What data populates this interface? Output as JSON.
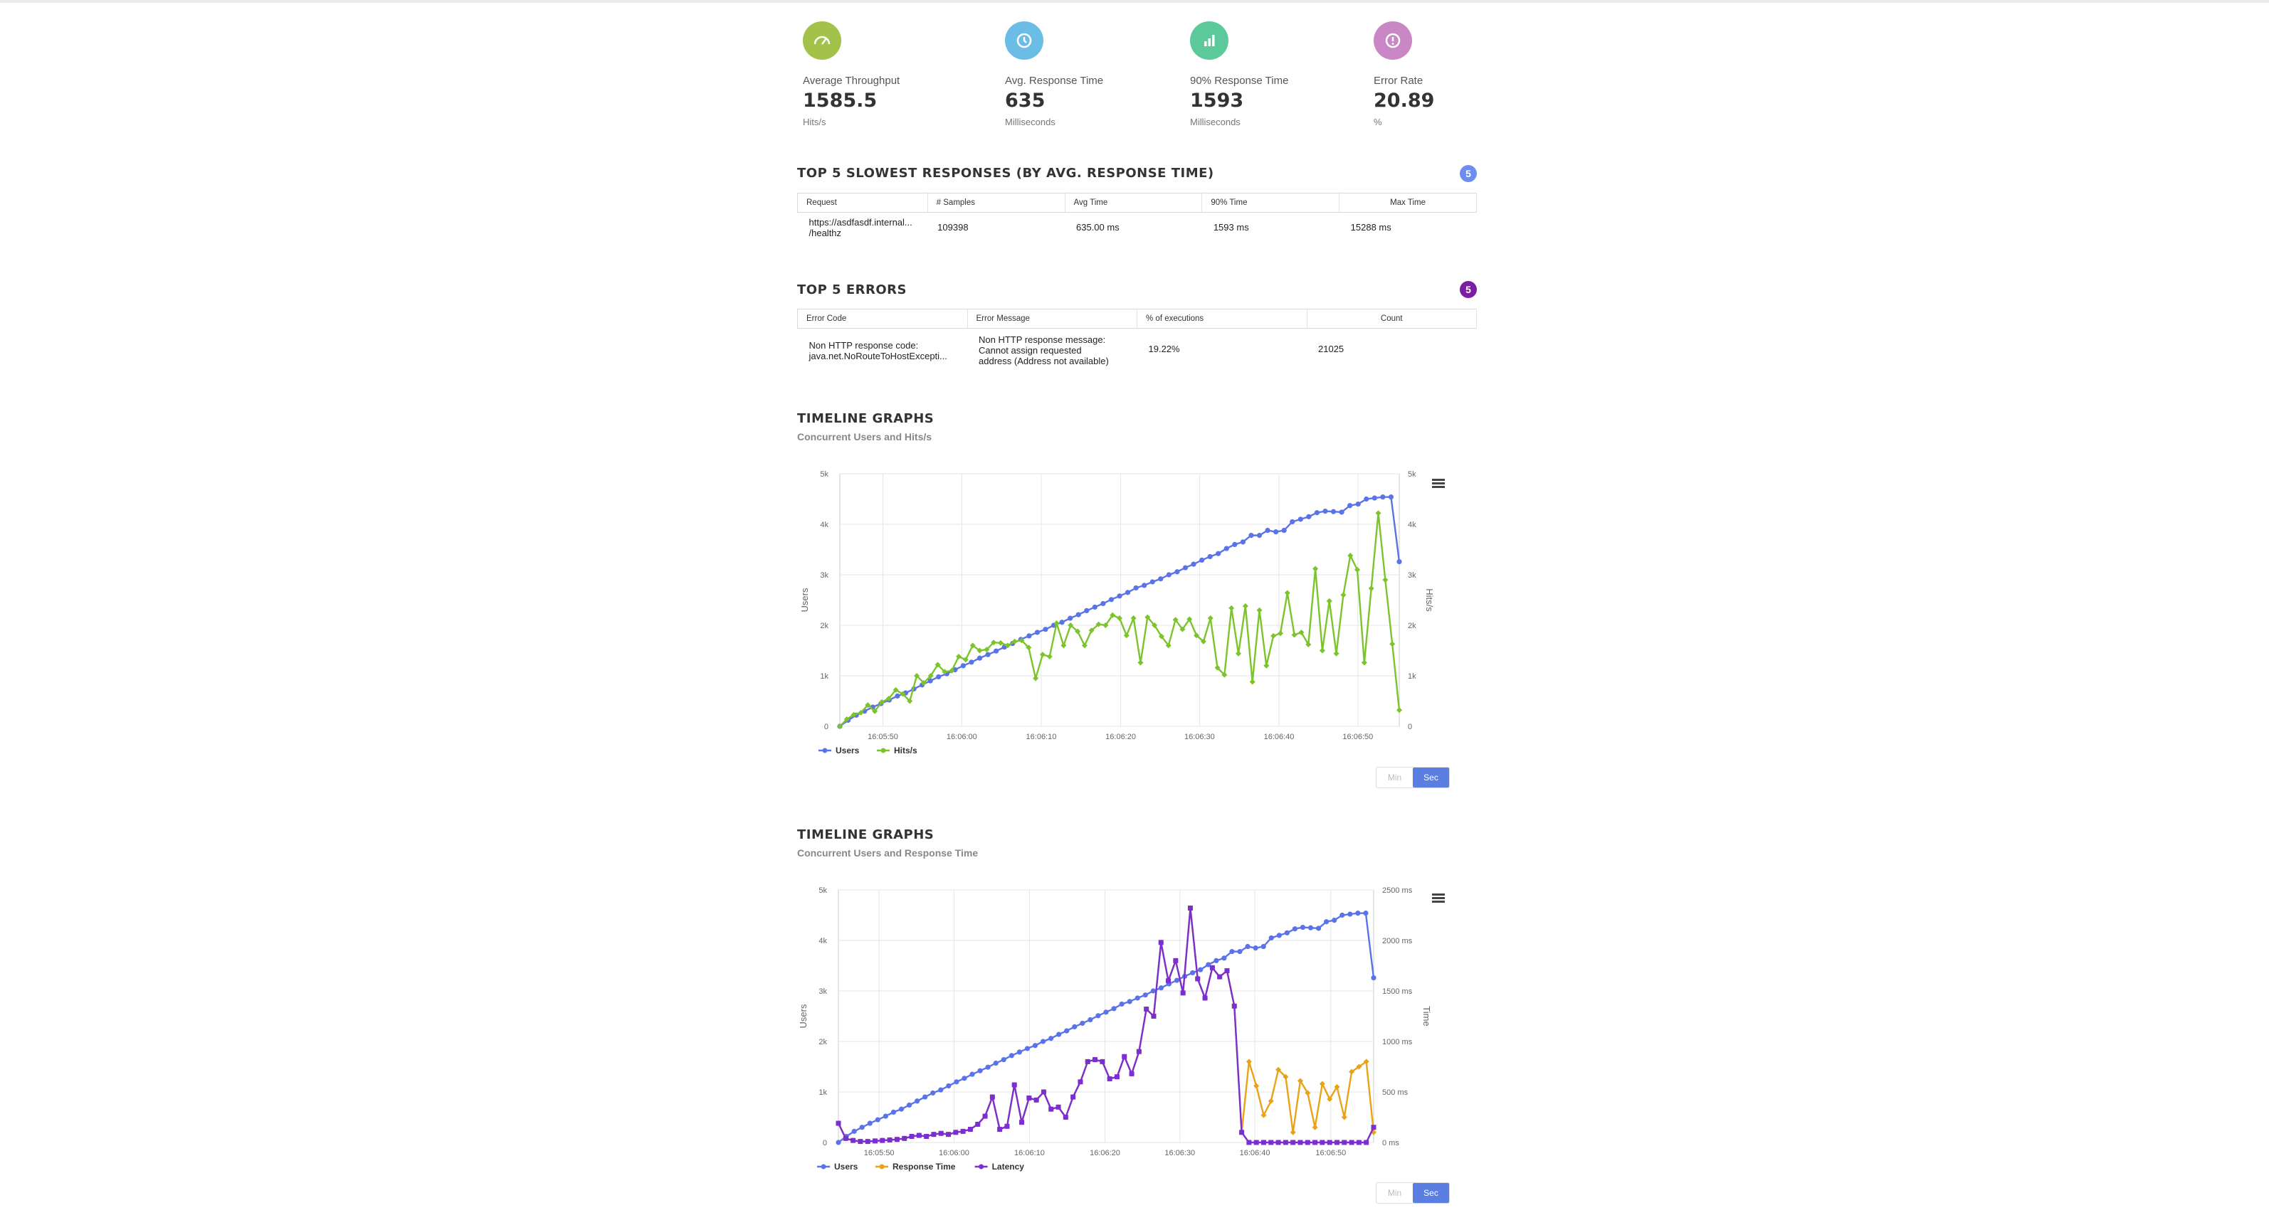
{
  "kpis": [
    {
      "label": "Average Throughput",
      "value": "1585.5",
      "unit": "Hits/s",
      "color": "#a3c24a",
      "icon": "gauge-icon"
    },
    {
      "label": "Avg. Response Time",
      "value": "635",
      "unit": "Milliseconds",
      "color": "#6cbde6",
      "icon": "clock-icon"
    },
    {
      "label": "90% Response Time",
      "value": "1593",
      "unit": "Milliseconds",
      "color": "#5cc99a",
      "icon": "bar-chart-icon"
    },
    {
      "label": "Error Rate",
      "value": "20.89",
      "unit": "%",
      "color": "#c987c6",
      "icon": "alert-icon"
    }
  ],
  "slowest": {
    "title": "TOP 5 SLOWEST RESPONSES (BY AVG. RESPONSE TIME)",
    "count": "5",
    "count_color": "#6d8ef0",
    "headers": [
      "Request",
      "# Samples",
      "Avg Time",
      "90% Time",
      "Max Time"
    ],
    "rows": [
      [
        "https://asdfasdf.internal...",
        "/healthz",
        "109398",
        "635.00 ms",
        "1593 ms",
        "15288 ms"
      ]
    ]
  },
  "errors": {
    "title": "TOP 5 ERRORS",
    "count": "5",
    "count_color": "#7a1fa2",
    "headers": [
      "Error Code",
      "Error Message",
      "% of executions",
      "Count"
    ],
    "row": {
      "code_l1": "Non HTTP response code:",
      "code_l2": "java.net.NoRouteToHostExcepti...",
      "msg_l1": "Non HTTP response message:",
      "msg_l2": "Cannot assign requested",
      "msg_l3": "address (Address not available)",
      "pct": "19.22%",
      "count": "21025"
    }
  },
  "timeline1": {
    "title": "TIMELINE GRAPHS",
    "subtitle": "Concurrent Users and Hits/s",
    "toggle_min": "Min",
    "toggle_sec": "Sec"
  },
  "timeline2": {
    "title": "TIMELINE GRAPHS",
    "subtitle": "Concurrent Users and Response Time",
    "toggle_min": "Min",
    "toggle_sec": "Sec"
  },
  "chart_data": [
    {
      "type": "line",
      "x_ticks": [
        "16:05:50",
        "16:06:00",
        "16:06:10",
        "16:06:20",
        "16:06:30",
        "16:06:40",
        "16:06:50"
      ],
      "ylabel": "Users",
      "y2label": "Hits/s",
      "y_ticks": [
        "0",
        "1k",
        "2k",
        "3k",
        "4k",
        "5k"
      ],
      "y2_ticks": [
        "0",
        "1k",
        "2k",
        "3k",
        "4k",
        "5k"
      ],
      "ylim": [
        0,
        5000
      ],
      "y2lim": [
        0,
        5000
      ],
      "grid": true,
      "legend_position": "bottom-left",
      "series": [
        {
          "name": "Users",
          "color": "#5b73e8",
          "axis": "left",
          "values": [
            0,
            120,
            220,
            300,
            380,
            450,
            520,
            600,
            660,
            740,
            820,
            900,
            980,
            1040,
            1120,
            1200,
            1270,
            1350,
            1420,
            1490,
            1570,
            1640,
            1720,
            1790,
            1860,
            1920,
            2000,
            2060,
            2140,
            2210,
            2290,
            2360,
            2430,
            2510,
            2580,
            2650,
            2740,
            2790,
            2860,
            2920,
            3000,
            3060,
            3140,
            3210,
            3290,
            3360,
            3420,
            3520,
            3600,
            3650,
            3780,
            3780,
            3880,
            3850,
            3880,
            4050,
            4100,
            4150,
            4230,
            4260,
            4250,
            4240,
            4370,
            4400,
            4500,
            4520,
            4540,
            4540,
            3260
          ]
        },
        {
          "name": "Hits/s",
          "color": "#7cc42b",
          "axis": "right",
          "values": [
            0,
            140,
            230,
            270,
            420,
            300,
            480,
            550,
            720,
            640,
            500,
            1000,
            860,
            1000,
            1220,
            1080,
            1100,
            1380,
            1320,
            1600,
            1500,
            1520,
            1660,
            1650,
            1600,
            1680,
            1700,
            1560,
            950,
            1420,
            1380,
            2040,
            1600,
            2000,
            1880,
            1600,
            1900,
            2020,
            2000,
            2200,
            2140,
            1800,
            2140,
            1260,
            2160,
            2000,
            1780,
            1600,
            2110,
            1920,
            2120,
            1800,
            1680,
            2140,
            1160,
            1020,
            2340,
            1440,
            2380,
            880,
            2300,
            1200,
            1790,
            1840,
            2640,
            1810,
            1860,
            1620,
            3120,
            1500,
            2480,
            1440,
            2600,
            3380,
            3100,
            1260,
            2730,
            4220,
            2900,
            1630,
            320
          ]
        }
      ]
    },
    {
      "type": "line",
      "x_ticks": [
        "16:05:50",
        "16:06:00",
        "16:06:10",
        "16:06:20",
        "16:06:30",
        "16:06:40",
        "16:06:50"
      ],
      "ylabel": "Users",
      "y2label": "Time",
      "y_ticks": [
        "0",
        "1k",
        "2k",
        "3k",
        "4k",
        "5k"
      ],
      "y2_ticks": [
        "0 ms",
        "500 ms",
        "1000 ms",
        "1500 ms",
        "2000 ms",
        "2500 ms"
      ],
      "ylim": [
        0,
        5000
      ],
      "y2lim": [
        0,
        2500
      ],
      "grid": true,
      "legend_position": "bottom-left",
      "series": [
        {
          "name": "Users",
          "color": "#5b73e8",
          "axis": "left",
          "values": [
            0,
            120,
            220,
            300,
            380,
            450,
            520,
            600,
            660,
            740,
            820,
            900,
            980,
            1040,
            1120,
            1200,
            1270,
            1350,
            1420,
            1490,
            1570,
            1640,
            1720,
            1790,
            1860,
            1920,
            2000,
            2060,
            2140,
            2210,
            2290,
            2360,
            2430,
            2510,
            2580,
            2650,
            2740,
            2790,
            2860,
            2920,
            3000,
            3060,
            3140,
            3210,
            3290,
            3360,
            3420,
            3520,
            3600,
            3650,
            3780,
            3780,
            3880,
            3850,
            3880,
            4050,
            4100,
            4150,
            4230,
            4260,
            4250,
            4240,
            4370,
            4400,
            4500,
            4520,
            4540,
            4540,
            3260
          ]
        },
        {
          "name": "Response Time",
          "color": "#e8a317",
          "axis": "right",
          "values": [
            190,
            40,
            20,
            10,
            10,
            15,
            20,
            25,
            30,
            40,
            60,
            70,
            60,
            80,
            90,
            80,
            100,
            110,
            130,
            180,
            260,
            450,
            130,
            160,
            570,
            200,
            440,
            420,
            500,
            330,
            350,
            250,
            450,
            600,
            800,
            820,
            800,
            630,
            650,
            850,
            680,
            900,
            1320,
            1250,
            1980,
            1600,
            1800,
            1480,
            2320,
            1620,
            1430,
            1730,
            1640,
            1700,
            1350,
            100,
            800,
            560,
            270,
            410,
            720,
            650,
            100,
            610,
            490,
            150,
            580,
            430,
            550,
            250,
            700,
            750,
            800,
            100
          ]
        },
        {
          "name": "Latency",
          "color": "#7b2fd2",
          "axis": "right",
          "values": [
            190,
            40,
            20,
            10,
            10,
            15,
            20,
            25,
            30,
            40,
            60,
            70,
            60,
            80,
            90,
            80,
            100,
            110,
            130,
            180,
            260,
            450,
            130,
            160,
            570,
            200,
            440,
            420,
            500,
            330,
            350,
            250,
            450,
            600,
            800,
            820,
            800,
            630,
            650,
            850,
            680,
            900,
            1320,
            1250,
            1980,
            1600,
            1800,
            1480,
            2320,
            1620,
            1430,
            1730,
            1640,
            1700,
            1350,
            100,
            0,
            0,
            0,
            0,
            0,
            0,
            0,
            0,
            0,
            0,
            0,
            0,
            0,
            0,
            0,
            0,
            0,
            150
          ]
        }
      ]
    }
  ]
}
